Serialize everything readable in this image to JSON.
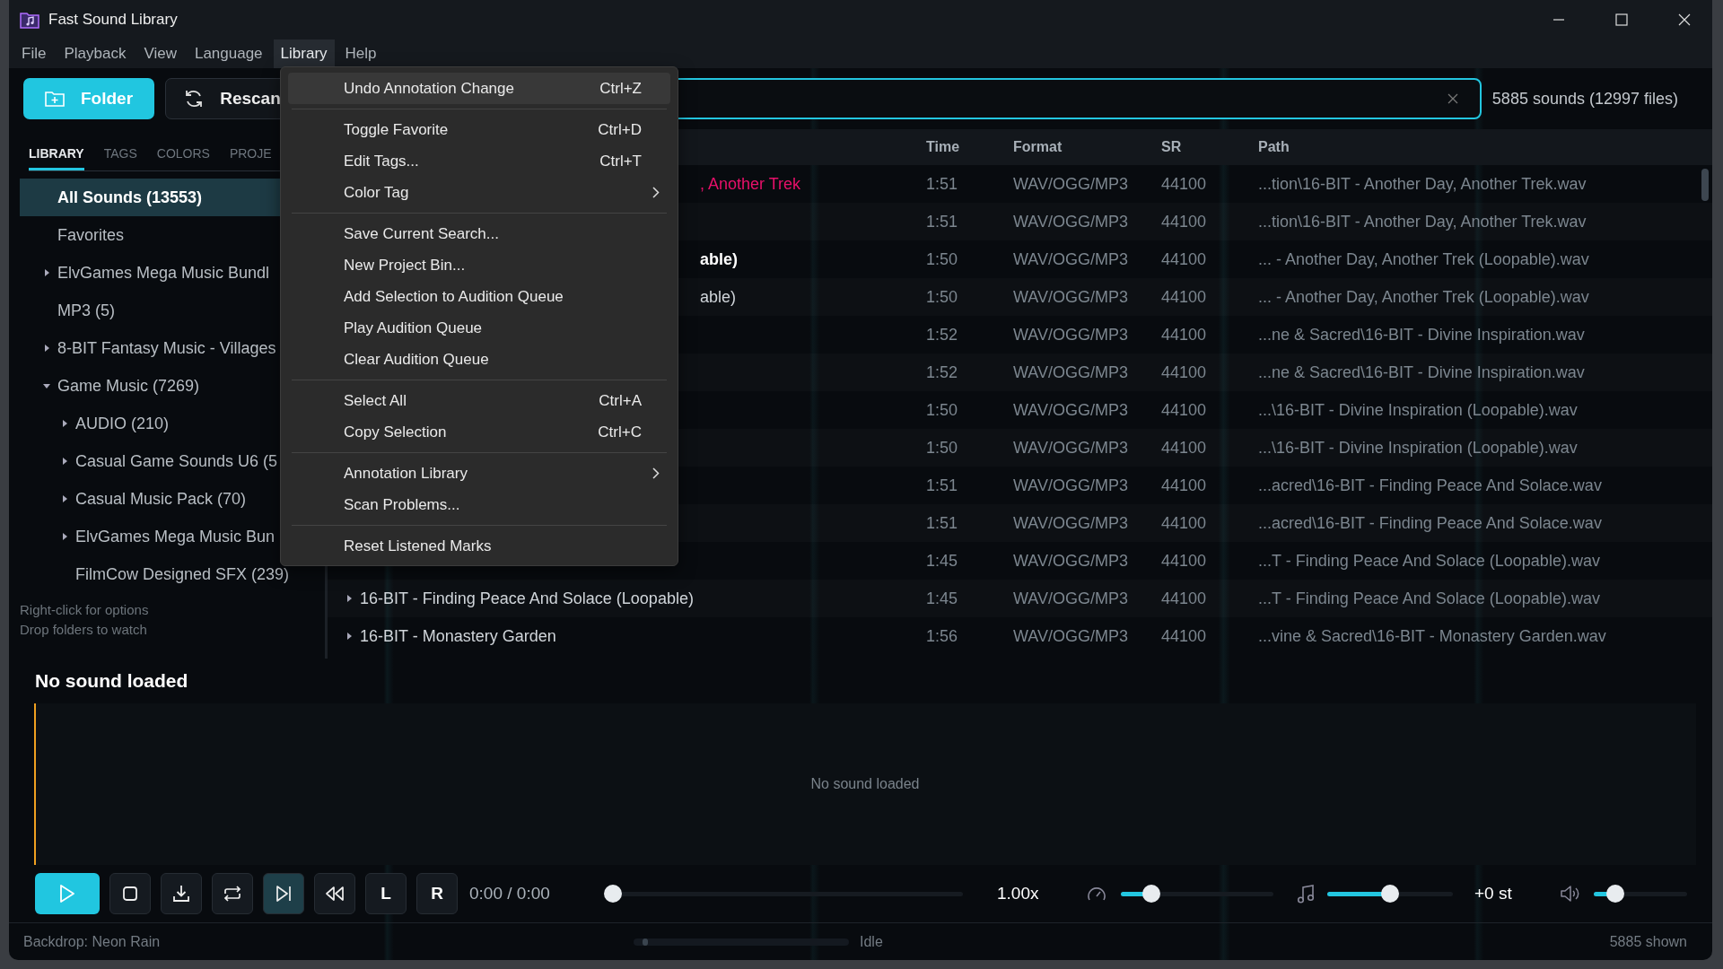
{
  "window": {
    "title": "Fast Sound Library"
  },
  "menubar": [
    {
      "label": "File",
      "selected": false
    },
    {
      "label": "Playback",
      "selected": false
    },
    {
      "label": "View",
      "selected": false
    },
    {
      "label": "Language",
      "selected": false
    },
    {
      "label": "Library",
      "selected": true
    },
    {
      "label": "Help",
      "selected": false
    }
  ],
  "toolbar": {
    "folder_button": "Folder",
    "rescan_button": "Rescan",
    "count": "5885 sounds (12997 files)"
  },
  "sidebar": {
    "tabs": [
      {
        "label": "LIBRARY",
        "selected": true
      },
      {
        "label": "TAGS",
        "selected": false
      },
      {
        "label": "COLORS",
        "selected": false
      },
      {
        "label": "PROJE",
        "selected": false
      }
    ],
    "items": [
      {
        "label": "All Sounds  (13553)",
        "selected": true
      },
      {
        "label": "Favorites",
        "selected": false
      },
      {
        "label": "ElvGames Mega Music Bundl",
        "selected": false,
        "expanded": false
      },
      {
        "label": "MP3  (5)",
        "selected": false
      },
      {
        "label": "8-BIT Fantasy Music - Villages",
        "selected": false,
        "expanded": false
      },
      {
        "label": "Game Music  (7269)",
        "selected": false,
        "expanded": true,
        "children": [
          {
            "label": "AUDIO  (210)",
            "selected": false,
            "expanded": false
          },
          {
            "label": "Casual Game Sounds U6  (5",
            "selected": false,
            "expanded": false
          },
          {
            "label": "Casual Music Pack  (70)",
            "selected": false,
            "expanded": false
          },
          {
            "label": "ElvGames Mega Music Bun",
            "selected": false,
            "expanded": false
          },
          {
            "label": "FilmCow Designed SFX  (239)",
            "selected": false
          }
        ]
      }
    ],
    "hints": [
      "Right-click for options",
      "Drop folders to watch"
    ]
  },
  "table": {
    "columns": [
      "Time",
      "Format",
      "SR",
      "Path"
    ],
    "rows": [
      {
        "name": ", Another Trek",
        "color": "#e8106a",
        "time": "1:51",
        "format": "WAV/OGG/MP3",
        "sr": "44100",
        "path": "...tion\\16-BIT - Another Day, Another Trek.wav"
      },
      {
        "time": "1:51",
        "format": "WAV/OGG/MP3",
        "sr": "44100",
        "path": "...tion\\16-BIT - Another Day, Another Trek.wav"
      },
      {
        "name": "able)",
        "bold": true,
        "time": "1:50",
        "format": "WAV/OGG/MP3",
        "sr": "44100",
        "path": "... - Another Day, Another Trek (Loopable).wav"
      },
      {
        "name": "able)",
        "time": "1:50",
        "format": "WAV/OGG/MP3",
        "sr": "44100",
        "path": "... - Another Day, Another Trek (Loopable).wav"
      },
      {
        "time": "1:52",
        "format": "WAV/OGG/MP3",
        "sr": "44100",
        "path": "...ne & Sacred\\16-BIT - Divine Inspiration.wav"
      },
      {
        "time": "1:52",
        "format": "WAV/OGG/MP3",
        "sr": "44100",
        "path": "...ne & Sacred\\16-BIT - Divine Inspiration.wav"
      },
      {
        "time": "1:50",
        "format": "WAV/OGG/MP3",
        "sr": "44100",
        "path": "...\\16-BIT - Divine Inspiration (Loopable).wav"
      },
      {
        "time": "1:50",
        "format": "WAV/OGG/MP3",
        "sr": "44100",
        "path": "...\\16-BIT - Divine Inspiration (Loopable).wav"
      },
      {
        "time": "1:51",
        "format": "WAV/OGG/MP3",
        "sr": "44100",
        "path": "...acred\\16-BIT - Finding Peace And Solace.wav"
      },
      {
        "time": "1:51",
        "format": "WAV/OGG/MP3",
        "sr": "44100",
        "path": "...acred\\16-BIT - Finding Peace And Solace.wav"
      },
      {
        "time": "1:45",
        "format": "WAV/OGG/MP3",
        "sr": "44100",
        "path": "...T - Finding Peace And Solace (Loopable).wav"
      },
      {
        "name": "16-BIT - Finding Peace And Solace (Loopable)",
        "expanded": false,
        "time": "1:45",
        "format": "WAV/OGG/MP3",
        "sr": "44100",
        "path": "...T - Finding Peace And Solace (Loopable).wav"
      },
      {
        "name": "16-BIT - Monastery Garden",
        "expanded": false,
        "time": "1:56",
        "format": "WAV/OGG/MP3",
        "sr": "44100",
        "path": "...vine & Sacred\\16-BIT - Monastery Garden.wav"
      }
    ]
  },
  "menu": {
    "groups": [
      [
        {
          "label": "Undo Annotation Change",
          "shortcut": "Ctrl+Z",
          "selected": true
        }
      ],
      [
        {
          "label": "Toggle Favorite",
          "shortcut": "Ctrl+D",
          "selected": false
        },
        {
          "label": "Edit Tags...",
          "shortcut": "Ctrl+T",
          "selected": false
        },
        {
          "label": "Color Tag",
          "submenu": true,
          "selected": false
        }
      ],
      [
        {
          "label": "Save Current Search...",
          "selected": false
        },
        {
          "label": "New Project Bin...",
          "selected": false
        },
        {
          "label": "Add Selection to Audition Queue",
          "selected": false
        },
        {
          "label": "Play Audition Queue",
          "selected": false
        },
        {
          "label": "Clear Audition Queue",
          "selected": false
        }
      ],
      [
        {
          "label": "Select All",
          "shortcut": "Ctrl+A",
          "selected": false
        },
        {
          "label": "Copy Selection",
          "shortcut": "Ctrl+C",
          "selected": false
        }
      ],
      [
        {
          "label": "Annotation Library",
          "submenu": true,
          "selected": false
        },
        {
          "label": "Scan Problems...",
          "selected": false
        }
      ],
      [
        {
          "label": "Reset Listened Marks",
          "selected": false
        }
      ]
    ]
  },
  "player": {
    "title": "No sound loaded",
    "waveform_message": "No sound loaded",
    "controls": [
      {
        "kind": "play",
        "active": true
      },
      {
        "kind": "stop",
        "active": false
      },
      {
        "kind": "export",
        "active": false
      },
      {
        "kind": "loop",
        "active": false
      },
      {
        "kind": "next",
        "active": true
      },
      {
        "kind": "rewind",
        "active": false
      },
      {
        "kind": "text",
        "label": "L",
        "active": false
      },
      {
        "kind": "text",
        "label": "R",
        "active": false
      }
    ],
    "time": "0:00 / 0:00",
    "seek": {
      "level": 0
    },
    "speed": "1.00x",
    "speed_slider": {
      "level": 0.2
    },
    "pitch_slider": {
      "level": 0.5
    },
    "pitch": "+0 st",
    "volume": {
      "level": 0.23
    }
  },
  "status_bar": {
    "backdrop": "Backdrop: Neon Rain",
    "progress": {
      "level": 0.03
    },
    "state": "Idle",
    "shown": "5885 shown"
  }
}
